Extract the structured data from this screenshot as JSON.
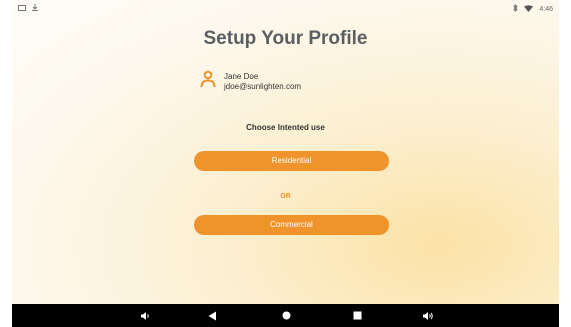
{
  "status_bar": {
    "time": "4:46"
  },
  "page": {
    "title": "Setup Your Profile",
    "user_name": "Jane Doe",
    "user_email": "jdoe@sunlighten.com",
    "prompt": "Choose Intented use",
    "option_residential": "Residential",
    "or_label": "OR",
    "option_commercial": "Commercial"
  },
  "colors": {
    "accent": "#f0932b",
    "title": "#5a5f63"
  },
  "icons": [
    "gallery-icon",
    "download-icon",
    "bluetooth-icon",
    "wifi-icon",
    "user-icon",
    "volume-down-icon",
    "back-icon",
    "home-icon",
    "recents-icon",
    "volume-up-icon"
  ]
}
